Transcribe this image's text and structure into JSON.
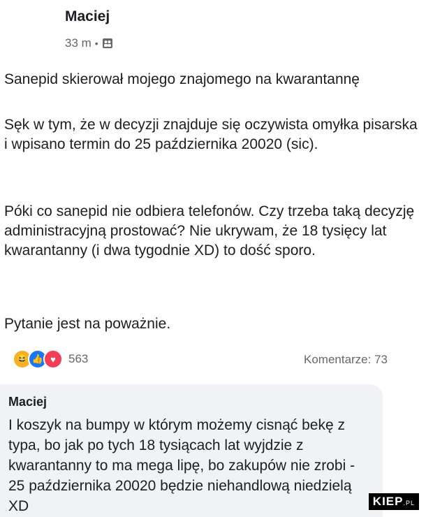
{
  "post": {
    "author": "Maciej",
    "time": "33 m",
    "separator": "•",
    "audience_icon": "group-icon",
    "paragraphs": [
      "Sanepid skierował mojego znajomego na kwarantannę",
      "Sęk w tym, że w decyzji znajduje się oczywista omyłka pisarska i wpisano termin do 25 października 20020 (sic).",
      "Póki co sanepid nie odbiera telefonów. Czy trzeba taką decyzję administracyjną prostować? Nie ukrywam, że 18 tysięcy lat kwarantanny (i dwa tygodnie XD) to dość sporo.",
      "Pytanie jest na poważnie."
    ],
    "reactions": {
      "icons": [
        "haha-reaction-icon",
        "like-reaction-icon",
        "love-reaction-icon"
      ],
      "count": "563"
    },
    "comments_count": "Komentarze: 73"
  },
  "comment": {
    "author": "Maciej",
    "text": "I koszyk na bumpy w którym możemy cisnąć bekę z typa, bo jak po tych 18 tysiącach lat wyjdzie z kwarantanny to ma mega lipę, bo zakupów nie zrobi - 25 października 20020 będzie niehandlową niedzielą XD"
  },
  "watermark": {
    "main": "KIEP",
    "suffix": ".PL"
  },
  "colors": {
    "text": "#1c1e21",
    "secondary": "#65676b",
    "comment_bg": "#f0f2f5",
    "like": "#1877f2",
    "love": "#f33e58",
    "haha": "#f7b125"
  }
}
